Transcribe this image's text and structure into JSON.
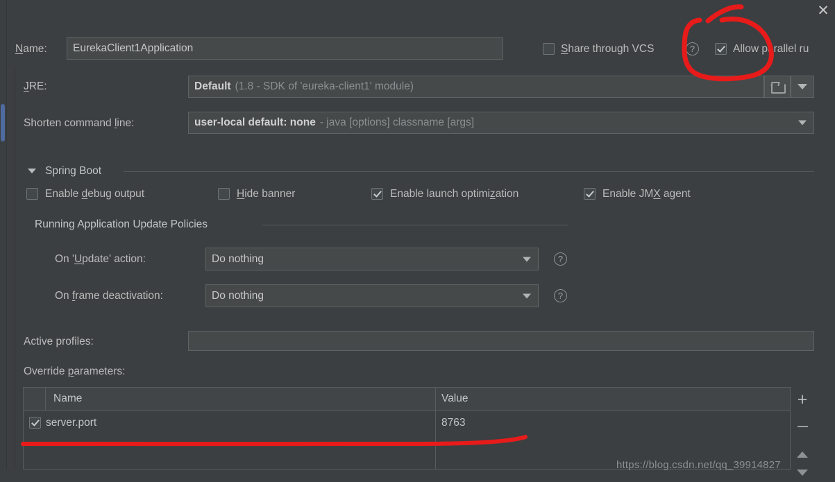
{
  "window": {
    "close_label": "✕"
  },
  "name_row": {
    "label_pre": "N",
    "label_accel": "a",
    "label_post": "me:",
    "label_full": "Name:",
    "value": "EurekaClient1Application"
  },
  "top_options": {
    "share_vcs_label": "Share through VCS",
    "share_vcs_checked": false,
    "help_label": "?",
    "allow_parallel_label": "Allow parallel ru",
    "allow_parallel_checked": true
  },
  "jre_row": {
    "label": "JRE:",
    "value_strong": "Default",
    "value_dim": "(1.8 - SDK of 'eureka-client1' module)",
    "browse_icon": "folder-icon",
    "dropdown_icon": "chevron-down-icon"
  },
  "shorten_row": {
    "label": "Shorten command line:",
    "value_strong": "user-local default: none",
    "value_dim": "- java [options] classname [args]"
  },
  "spring_boot": {
    "section_title": "Spring Boot",
    "checkboxes": [
      {
        "label": "Enable debug output",
        "checked": false
      },
      {
        "label": "Hide banner",
        "checked": false
      },
      {
        "label": "Enable launch optimization",
        "checked": true
      },
      {
        "label": "Enable JMX agent",
        "checked": true
      }
    ],
    "policies_title": "Running Application Update Policies",
    "update_action": {
      "label": "On 'Update' action:",
      "value": "Do nothing",
      "help": "?"
    },
    "frame_deactivation": {
      "label": "On frame deactivation:",
      "value": "Do nothing",
      "help": "?"
    }
  },
  "profiles": {
    "active_profiles_label": "Active profiles:",
    "active_profiles_value": "",
    "override_params_label": "Override parameters:"
  },
  "params_table": {
    "columns": [
      "Name",
      "Value"
    ],
    "rows": [
      {
        "checked": true,
        "name": "server.port",
        "value": "8763"
      }
    ],
    "buttons": {
      "add": "+",
      "remove": "−",
      "move_up": "move-up-icon",
      "move_down": "move-down-icon"
    }
  },
  "watermark": {
    "text": "https://blog.csdn.net/qq_39914827"
  },
  "colors": {
    "background": "#3c3f41",
    "field_background": "#45494a",
    "border": "#5e6364",
    "text": "#bbbbbb",
    "dim_text": "#8b8f8f",
    "annotation_red": "#e81b1b",
    "scrollbar_blue": "#4e6aa0"
  }
}
